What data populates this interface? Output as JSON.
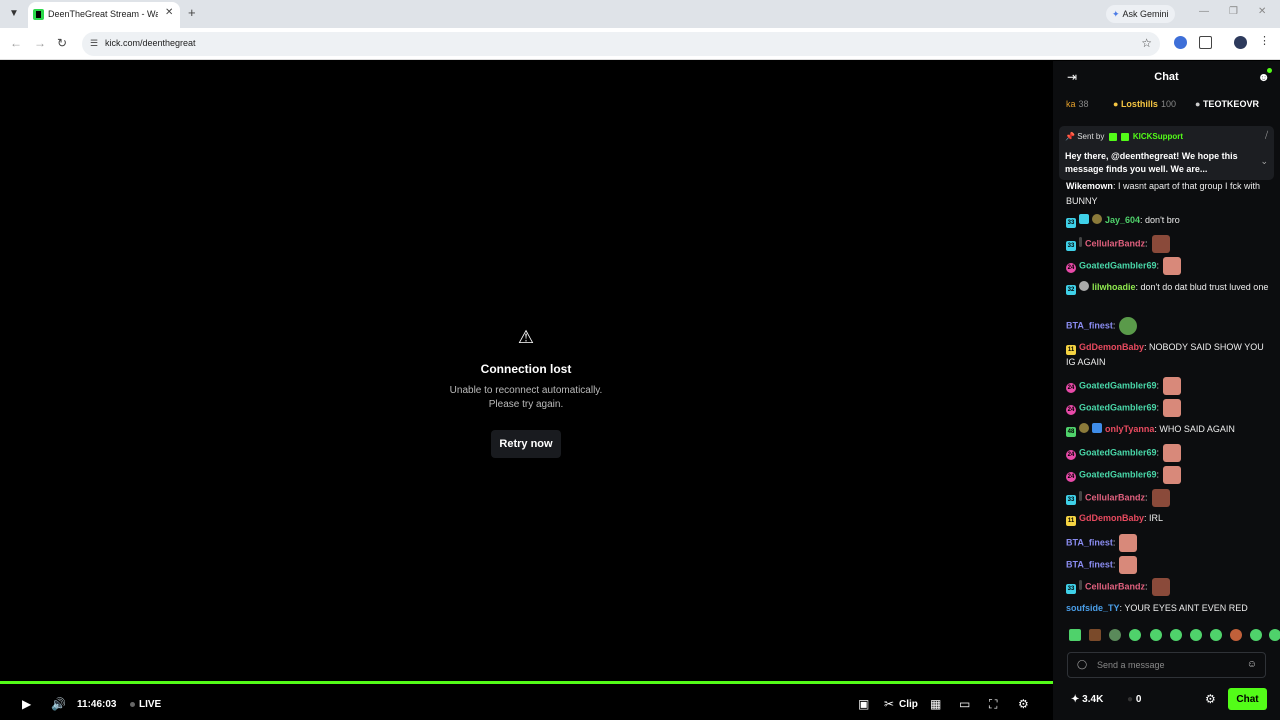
{
  "browser": {
    "tab_title": "DeenTheGreat Stream - Watch Live on Kick",
    "url": "kick.com/deenthegreat",
    "gemini_label": "Ask Gemini"
  },
  "player": {
    "error_title": "Connection lost",
    "error_line1": "Unable to reconnect automatically.",
    "error_line2": "Please try again.",
    "retry_label": "Retry now",
    "time": "11:46:03",
    "live_label": "LIVE",
    "clip_label": "Clip",
    "progress": 1.0,
    "accent": "#53fc18"
  },
  "chat": {
    "title": "Chat",
    "leaderboard": [
      {
        "name": "ka",
        "count": "38",
        "color": "#e5a02b"
      },
      {
        "name": "Losthills",
        "count": "100",
        "color": "#f5c542"
      },
      {
        "name": "TEOTKEOVR",
        "count": "",
        "color": "#ffffff"
      }
    ],
    "pinned": {
      "sent_by": "Sent by",
      "user": "KICKSupport",
      "message": "Hey there, @deenthegreat! We hope this message finds you well. We are..."
    },
    "messages": [
      {
        "user": "Wikemown",
        "color": "#ffffff",
        "text": ": I wasnt apart of that group I fck with BUNNY"
      },
      {
        "user": "Jay_604",
        "color": "#4fd26b",
        "text": ": don't bro"
      },
      {
        "user": "CellularBandz",
        "color": "#e0607e",
        "text": ":"
      },
      {
        "user": "GoatedGambler69",
        "color": "#49d6a8",
        "text": ":"
      },
      {
        "user": "lilwhoadie",
        "color": "#8fe84f",
        "text": ": don't do dat blud trust luved one"
      },
      {
        "user": "BTA_finest",
        "color": "#8a8cf0",
        "text": ":"
      },
      {
        "user": "GdDemonBaby",
        "color": "#e84a5f",
        "text": ": NOBODY SAID SHOW YOU IG AGAIN"
      },
      {
        "user": "GoatedGambler69",
        "color": "#49d6a8",
        "text": ":"
      },
      {
        "user": "GoatedGambler69",
        "color": "#49d6a8",
        "text": ":"
      },
      {
        "user": "onlyTyanna",
        "color": "#e84a5f",
        "text": ": WHO SAID AGAIN"
      },
      {
        "user": "GoatedGambler69",
        "color": "#49d6a8",
        "text": ":"
      },
      {
        "user": "GoatedGambler69",
        "color": "#49d6a8",
        "text": ":"
      },
      {
        "user": "CellularBandz",
        "color": "#e0607e",
        "text": ":"
      },
      {
        "user": "GdDemonBaby",
        "color": "#e84a5f",
        "text": ": IRL"
      },
      {
        "user": "BTA_finest",
        "color": "#8a8cf0",
        "text": ":"
      },
      {
        "user": "BTA_finest",
        "color": "#8a8cf0",
        "text": ":"
      },
      {
        "user": "CellularBandz",
        "color": "#e0607e",
        "text": ":"
      },
      {
        "user": "soufside_TY",
        "color": "#4a9ee8",
        "text": ": YOUR EYES AINT EVEN RED"
      }
    ],
    "input_placeholder": "Send a message",
    "viewer_count": "3.4K",
    "points": "0",
    "chat_button": "Chat"
  }
}
